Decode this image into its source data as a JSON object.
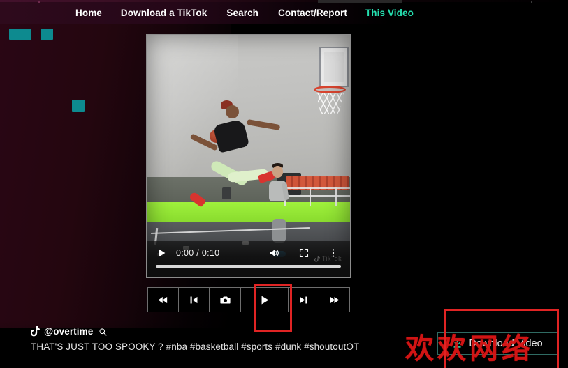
{
  "page": {
    "background_color": "#000000",
    "left_tint_color": "#2a0615",
    "accent_color": "#25e0b0"
  },
  "nav": {
    "items": [
      {
        "label": "Home",
        "active": false
      },
      {
        "label": "Download a TikTok",
        "active": false
      },
      {
        "label": "Search",
        "active": false
      },
      {
        "label": "Contact/Report",
        "active": false
      },
      {
        "label": "This Video",
        "active": true
      }
    ]
  },
  "placeholders": {
    "color": "#0d8a8f",
    "blocks": [
      "block-a",
      "block-b",
      "block-c"
    ]
  },
  "player": {
    "time_display": "0:00 / 0:10",
    "current_time": "0:00",
    "duration": "0:10",
    "progress_percent": 0,
    "watermark": "TikTok",
    "controls": {
      "play_label": "play",
      "volume_label": "mute",
      "fullscreen_label": "fullscreen",
      "more_label": "more options"
    },
    "video_description": "Basketball player dunking in an indoor gym with green turf and gray floor"
  },
  "button_strip": {
    "buttons": [
      {
        "name": "rewind",
        "icon": "fast-rewind-icon"
      },
      {
        "name": "step-back",
        "icon": "step-back-icon"
      },
      {
        "name": "screenshot",
        "icon": "camera-icon"
      },
      {
        "name": "play",
        "icon": "play-icon"
      },
      {
        "name": "step-forward",
        "icon": "step-forward-icon"
      },
      {
        "name": "fast-forward",
        "icon": "fast-forward-icon"
      }
    ]
  },
  "meta": {
    "username": "@overtime",
    "caption": "THAT'S JUST TOO SPOOKY ? #nba #basketball #sports #dunk #shoutoutOT",
    "search_icon": "magnifier-icon",
    "logo": "tiktok-logo-icon"
  },
  "download": {
    "label": "Download Video",
    "icon": "download-icon",
    "border_color": "#2f6b63",
    "icon_color": "#29c39a"
  },
  "watermark": {
    "text": "欢欢网络",
    "color": "#d61616"
  },
  "annotations": {
    "color": "#e02424",
    "boxes": [
      {
        "name": "play-button-highlight"
      },
      {
        "name": "download-button-highlight"
      }
    ]
  }
}
